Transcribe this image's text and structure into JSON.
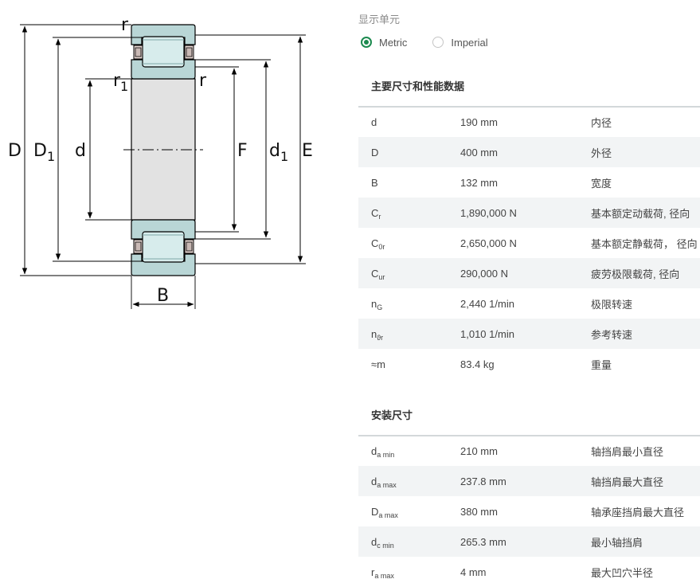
{
  "drawing": {
    "labels": {
      "D": "D",
      "D1_main": "D",
      "D1_sub": "1",
      "d": "d",
      "F": "F",
      "d1_main": "d",
      "d1_sub": "1",
      "E": "E",
      "B": "B",
      "r_top": "r",
      "r1_main": "r",
      "r1_sub": "1",
      "r_mid": "r"
    },
    "colors": {
      "ring": "#b9d6d6",
      "bore": "#e2e2e2",
      "roller": "#d7ecec",
      "cage": "#e2d2ce",
      "line": "#000000"
    }
  },
  "units": {
    "label": "显示单元",
    "options": [
      {
        "label": "Metric",
        "selected": true
      },
      {
        "label": "Imperial",
        "selected": false
      }
    ],
    "accent": "#1c8a4f"
  },
  "main_dims": {
    "title": "主要尺寸和性能数据",
    "rows": [
      {
        "sym": "d",
        "sub": "",
        "value": "190 mm",
        "desc": "内径"
      },
      {
        "sym": "D",
        "sub": "",
        "value": "400 mm",
        "desc": "外径"
      },
      {
        "sym": "B",
        "sub": "",
        "value": "132 mm",
        "desc": "宽度"
      },
      {
        "sym": "C",
        "sub": "r",
        "value": "1,890,000 N",
        "desc": "基本额定动载荷, 径向"
      },
      {
        "sym": "C",
        "sub": "0r",
        "value": "2,650,000 N",
        "desc": "基本额定静载荷， 径向"
      },
      {
        "sym": "C",
        "sub": "ur",
        "value": "290,000 N",
        "desc": "疲劳极限载荷, 径向"
      },
      {
        "sym": "n",
        "sub": "G",
        "value": "2,440 1/min",
        "desc": "极限转速"
      },
      {
        "sym": "n",
        "sub": "ϑr",
        "value": "1,010 1/min",
        "desc": "参考转速"
      },
      {
        "sym": "≈m",
        "sub": "",
        "value": "83.4 kg",
        "desc": "重量"
      }
    ]
  },
  "mounting_dims": {
    "title": "安装尺寸",
    "rows": [
      {
        "sym": "d",
        "sub": "a min",
        "value": "210 mm",
        "desc": "轴挡肩最小直径"
      },
      {
        "sym": "d",
        "sub": "a max",
        "value": "237.8 mm",
        "desc": "轴挡肩最大直径"
      },
      {
        "sym": "D",
        "sub": "a max",
        "value": "380 mm",
        "desc": "轴承座挡肩最大直径"
      },
      {
        "sym": "d",
        "sub": "c min",
        "value": "265.3 mm",
        "desc": "最小轴挡肩"
      },
      {
        "sym": "r",
        "sub": "a max",
        "value": "4 mm",
        "desc": "最大凹穴半径"
      }
    ]
  }
}
